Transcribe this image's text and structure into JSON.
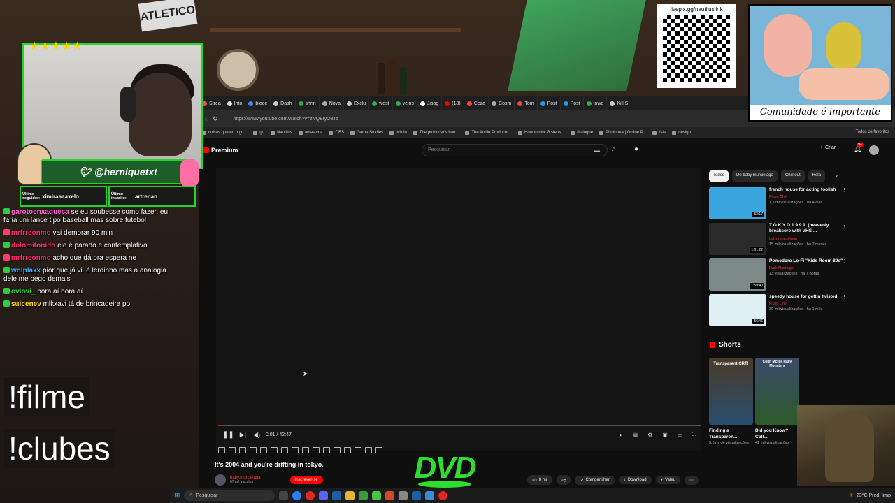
{
  "browser": {
    "tabs": [
      {
        "label": "Strea",
        "color": "#ff4b4b"
      },
      {
        "label": "Into",
        "color": "#e0e0e0"
      },
      {
        "label": "blooc",
        "color": "#4285f4"
      },
      {
        "label": "Dash",
        "color": "#cccccc"
      },
      {
        "label": "shrin",
        "color": "#34a853"
      },
      {
        "label": "Nova",
        "color": "#aaaaaa"
      },
      {
        "label": "Exclu",
        "color": "#cccccc"
      },
      {
        "label": "west",
        "color": "#34a853"
      },
      {
        "label": "veins",
        "color": "#34a853"
      },
      {
        "label": "Jisog",
        "color": "#ffffff"
      },
      {
        "label": "(18)",
        "color": "#ff0000"
      },
      {
        "label": "Ceza",
        "color": "#ff4040"
      },
      {
        "label": "Cosm",
        "color": "#aaaaaa"
      },
      {
        "label": "Tom",
        "color": "#ff4040"
      },
      {
        "label": "Post",
        "color": "#1d9bf0"
      },
      {
        "label": "Post",
        "color": "#1d9bf0"
      },
      {
        "label": "towe",
        "color": "#34a853"
      },
      {
        "label": "Kill S",
        "color": "#cccccc"
      }
    ],
    "url": "https://www.youtube.com/watch?v=zlvQEIyO3Ts",
    "bookmarks": [
      "coisas que eu n gu...",
      "gu",
      "Nautilus",
      "aulas cria",
      "OBS",
      "Game Studies",
      "itch.io",
      "The producer's han...",
      "The Audio Producer...",
      "How to mix: 8 steps...",
      "dialogue",
      "Photopea | Online P...",
      "lists",
      "design"
    ],
    "bookmarks_right": "Todos os favoritos"
  },
  "youtube": {
    "logo": "Premium",
    "search_placeholder": "Pesquisar",
    "create_label": "Criar",
    "notif_count": "9+",
    "player_time": "0:01 / 42:47",
    "video_title": "It's 2004 and you're drifting in tokyo.",
    "channel_name": "baby.murcielaga",
    "channel_subs": "67 mil inscritos",
    "subscribe_label": "Inscrever-se",
    "likes": "8 mil",
    "share_label": "Compartilhar",
    "download_label": "Download",
    "thanks_label": "Valeu",
    "chips": [
      "Todos",
      "De baby.murcielaga",
      "Chill out",
      "Rela"
    ],
    "recommendations": [
      {
        "title": "french house for acting foolish",
        "channel": "Fluxo Chill",
        "views": "1,1 mi visualizações · há 4 dias",
        "duration": "53:17",
        "color": "#3aa6e0"
      },
      {
        "title": "T O K Y O 1 9 9 9. (heavenly breakcore with VHS ...",
        "channel": "baby.murcielaga",
        "views": "15 mil visualizações · há 7 meses",
        "duration": "1:01:22",
        "color": "#2a2a2a"
      },
      {
        "title": "Pomodoro Lo-Fi \"Kids Room 80s\"",
        "channel": "Dark Nostalgia",
        "views": "13 visualizações · há 7 horas",
        "duration": "1:59:40",
        "color": "#7b8a86"
      },
      {
        "title": "speedy house for gettin twisted",
        "channel": "Fluxo Chill",
        "views": "39 mil visualizações · há 1 mês",
        "duration": "56:46",
        "color": "#dff0f5"
      }
    ],
    "shorts_title": "Shorts",
    "shorts": [
      {
        "title": "Finding a Transparen...",
        "views": "5,5 mi de visualizações",
        "overlay": "Transparent CRT!"
      },
      {
        "title": "Did you Know? Coll...",
        "views": "41 mil visualizações",
        "overlay": "Colin Mcrae Rally Monsters"
      }
    ]
  },
  "overlay": {
    "twitter_handle": "@herniquetxt",
    "last_follower_label": "Último seguidor:",
    "last_follower": "ximiraaaaxelo",
    "last_sub_label": "Último inscrito:",
    "last_sub": "artrenan",
    "qr_url": "livepix.gg/nautiluslink",
    "comic_caption": "Comunidade é importante",
    "dvd_text": "DVD",
    "commands": [
      "!filme",
      "!clubes"
    ],
    "chat": [
      {
        "user": "garotoenxaqueca",
        "text": "se eu soubesse como fazer, eu faria um lance tipo baseball mas sobre futebol",
        "color": "#ff6ad5",
        "badge": "#2ecc40"
      },
      {
        "user": "mrfrreonmo",
        "text": "vai demorar 90 min",
        "color": "#ff2a6d",
        "badge": "#ff3b6b"
      },
      {
        "user": "dolomitonido",
        "text": "ele é parado e contemplativo",
        "color": "#ff2a6d",
        "badge": "#2ecc40"
      },
      {
        "user": "mrfrreonmo",
        "text": "acho que dá pra espera ne",
        "color": "#ff2a6d",
        "badge": "#ff3b6b"
      },
      {
        "user": "wnlplaxx",
        "text": "pior que já vi. é lerdinho mas a analogia dele me pego demais",
        "color": "#4aa8ff",
        "badge": "#2ecc40"
      },
      {
        "user": "ovlovi_",
        "text": "bora aí bora aí",
        "color": "#22dd44",
        "badge": "#2ecc40"
      },
      {
        "user": "suicenev",
        "text": "mlkxavi tá de brincadeira po",
        "color": "#ffd400",
        "badge": "#2ecc40"
      }
    ]
  },
  "taskbar": {
    "search_placeholder": "Pesquisar",
    "weather": "23°C Pred. limp"
  }
}
